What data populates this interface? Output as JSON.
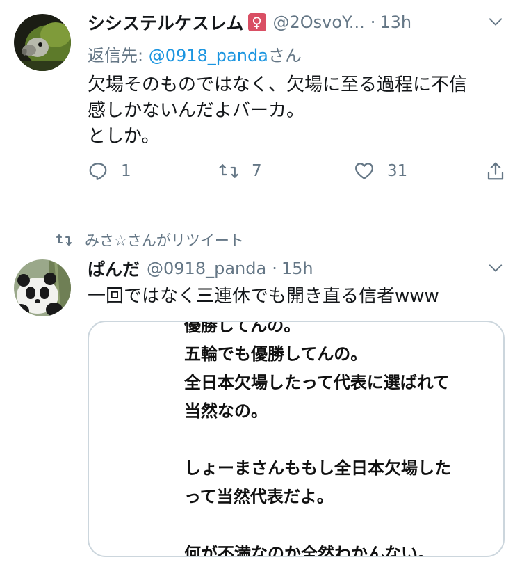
{
  "tweet1": {
    "display_name": "シシステルケスレム",
    "badge": "♀",
    "handle": "@2OsvoY...",
    "separator": "·",
    "time": "13h",
    "replying_prefix": "返信先: ",
    "replying_mention": "@0918_panda",
    "replying_suffix": "さん",
    "text": "欠場そのものではなく、欠場に至る過程に不信\n感しかないんだよバーカ。\nとしか。",
    "actions": {
      "reply_count": "1",
      "retweet_count": "7",
      "like_count": "31"
    }
  },
  "retweet_context": {
    "label": "みさ☆さんがリツイート"
  },
  "tweet2": {
    "display_name": "ぱんだ",
    "handle": "@0918_panda",
    "separator": "·",
    "time": "15h",
    "text": "一回ではなく三連休でも開き直る信者www",
    "media_text": "優勝してんの。\n五輪でも優勝してんの。\n全日本欠場したって代表に選ばれて\n当然なの。\n\nしょーまさんももし全日本欠場した\nって当然代表だよ。\n\n何が不満なのか全然わかんない。"
  },
  "colors": {
    "text": "#14171a",
    "muted": "#657786",
    "link": "#1b95e0",
    "badge": "#d94f64",
    "divider": "#e6ecf0"
  }
}
